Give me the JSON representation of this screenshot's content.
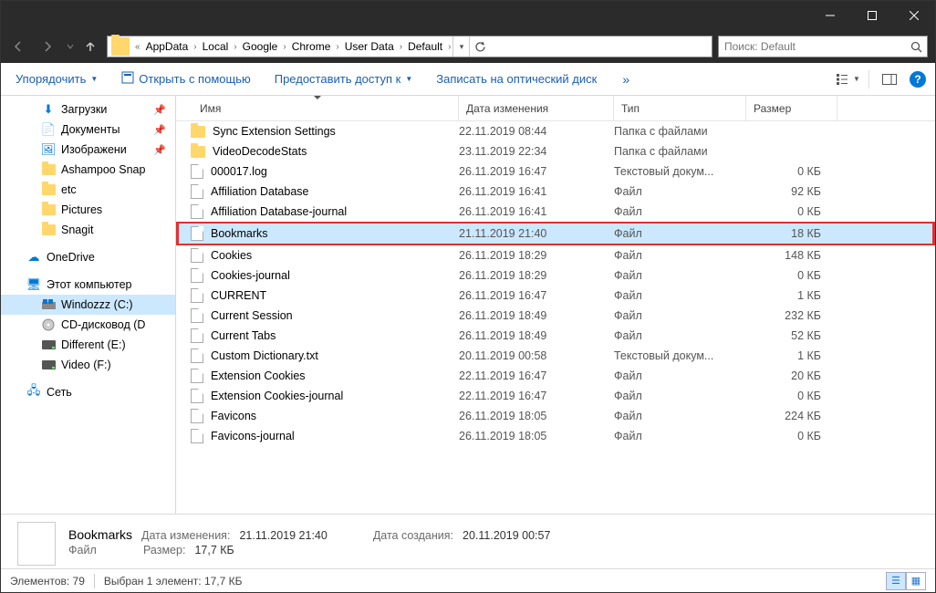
{
  "breadcrumb": [
    "AppData",
    "Local",
    "Google",
    "Chrome",
    "User Data",
    "Default"
  ],
  "search": {
    "placeholder": "Поиск: Default"
  },
  "toolbar": {
    "organize": "Упорядочить",
    "open_with": "Открыть с помощью",
    "share_access": "Предоставить доступ к",
    "burn": "Записать на оптический диск"
  },
  "sidebar": {
    "quick": [
      {
        "label": "Загрузки",
        "icon": "downloads",
        "pinned": true
      },
      {
        "label": "Документы",
        "icon": "documents",
        "pinned": true
      },
      {
        "label": "Изображени",
        "icon": "pictures",
        "pinned": true
      },
      {
        "label": "Ashampoo Snap",
        "icon": "folder",
        "pinned": false
      },
      {
        "label": "etc",
        "icon": "folder",
        "pinned": false
      },
      {
        "label": "Pictures",
        "icon": "folder",
        "pinned": false
      },
      {
        "label": "Snagit",
        "icon": "folder",
        "pinned": false
      }
    ],
    "onedrive": "OneDrive",
    "thispc": "Этот компьютер",
    "drives": [
      {
        "label": "Windozzz (C:)",
        "icon": "os-drive",
        "selected": true
      },
      {
        "label": "CD-дисковод (D",
        "icon": "cd-drive"
      },
      {
        "label": "Different (E:)",
        "icon": "drive"
      },
      {
        "label": "Video (F:)",
        "icon": "drive"
      }
    ],
    "network": "Сеть"
  },
  "columns": {
    "name": "Имя",
    "date": "Дата изменения",
    "type": "Тип",
    "size": "Размер"
  },
  "files": [
    {
      "name": "Sync Extension Settings",
      "date": "22.11.2019 08:44",
      "type": "Папка с файлами",
      "size": "",
      "kind": "folder"
    },
    {
      "name": "VideoDecodeStats",
      "date": "23.11.2019 22:34",
      "type": "Папка с файлами",
      "size": "",
      "kind": "folder"
    },
    {
      "name": "000017.log",
      "date": "26.11.2019 16:47",
      "type": "Текстовый докум...",
      "size": "0 КБ",
      "kind": "file"
    },
    {
      "name": "Affiliation Database",
      "date": "26.11.2019 16:41",
      "type": "Файл",
      "size": "92 КБ",
      "kind": "file"
    },
    {
      "name": "Affiliation Database-journal",
      "date": "26.11.2019 16:41",
      "type": "Файл",
      "size": "0 КБ",
      "kind": "file"
    },
    {
      "name": "Bookmarks",
      "date": "21.11.2019 21:40",
      "type": "Файл",
      "size": "18 КБ",
      "kind": "file",
      "selected": true
    },
    {
      "name": "Cookies",
      "date": "26.11.2019 18:29",
      "type": "Файл",
      "size": "148 КБ",
      "kind": "file"
    },
    {
      "name": "Cookies-journal",
      "date": "26.11.2019 18:29",
      "type": "Файл",
      "size": "0 КБ",
      "kind": "file"
    },
    {
      "name": "CURRENT",
      "date": "26.11.2019 16:47",
      "type": "Файл",
      "size": "1 КБ",
      "kind": "file"
    },
    {
      "name": "Current Session",
      "date": "26.11.2019 18:49",
      "type": "Файл",
      "size": "232 КБ",
      "kind": "file"
    },
    {
      "name": "Current Tabs",
      "date": "26.11.2019 18:49",
      "type": "Файл",
      "size": "52 КБ",
      "kind": "file"
    },
    {
      "name": "Custom Dictionary.txt",
      "date": "20.11.2019 00:58",
      "type": "Текстовый докум...",
      "size": "1 КБ",
      "kind": "file"
    },
    {
      "name": "Extension Cookies",
      "date": "22.11.2019 16:47",
      "type": "Файл",
      "size": "20 КБ",
      "kind": "file"
    },
    {
      "name": "Extension Cookies-journal",
      "date": "22.11.2019 16:47",
      "type": "Файл",
      "size": "0 КБ",
      "kind": "file"
    },
    {
      "name": "Favicons",
      "date": "26.11.2019 18:05",
      "type": "Файл",
      "size": "224 КБ",
      "kind": "file"
    },
    {
      "name": "Favicons-journal",
      "date": "26.11.2019 18:05",
      "type": "Файл",
      "size": "0 КБ",
      "kind": "file"
    }
  ],
  "details": {
    "name": "Bookmarks",
    "type_label": "Файл",
    "modified_label": "Дата изменения:",
    "modified": "21.11.2019 21:40",
    "size_label": "Размер:",
    "size": "17,7 КБ",
    "created_label": "Дата создания:",
    "created": "20.11.2019 00:57"
  },
  "status": {
    "count": "Элементов: 79",
    "selection": "Выбран 1 элемент: 17,7 КБ"
  }
}
